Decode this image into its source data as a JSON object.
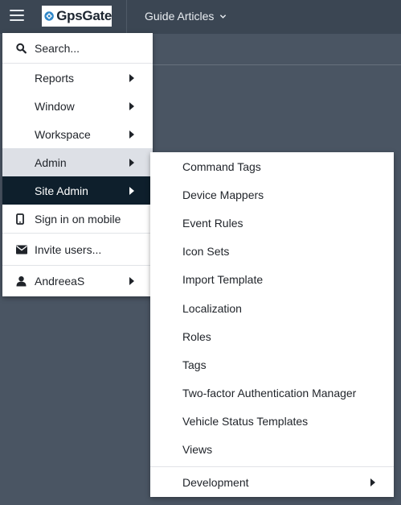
{
  "topbar": {
    "logo_text": "GpsGate",
    "guide_label": "Guide Articles"
  },
  "menu": {
    "search_label": "Search...",
    "reports_label": "Reports",
    "window_label": "Window",
    "workspace_label": "Workspace",
    "admin_label": "Admin",
    "site_admin_label": "Site Admin",
    "mobile_label": "Sign in on mobile",
    "invite_label": "Invite users...",
    "user_label": "AndreeaS"
  },
  "submenu": {
    "items": [
      "Command Tags",
      "Device Mappers",
      "Event Rules",
      "Icon Sets",
      "Import Template",
      "Localization",
      "Roles",
      "Tags",
      "Two-factor Authentication Manager",
      "Vehicle Status Templates",
      "Views"
    ],
    "development_label": "Development"
  },
  "colors": {
    "background": "#4a5563",
    "topbar": "#3b4653",
    "selected_dark": "#0e1f2c",
    "selected_light": "#dde0e6"
  }
}
